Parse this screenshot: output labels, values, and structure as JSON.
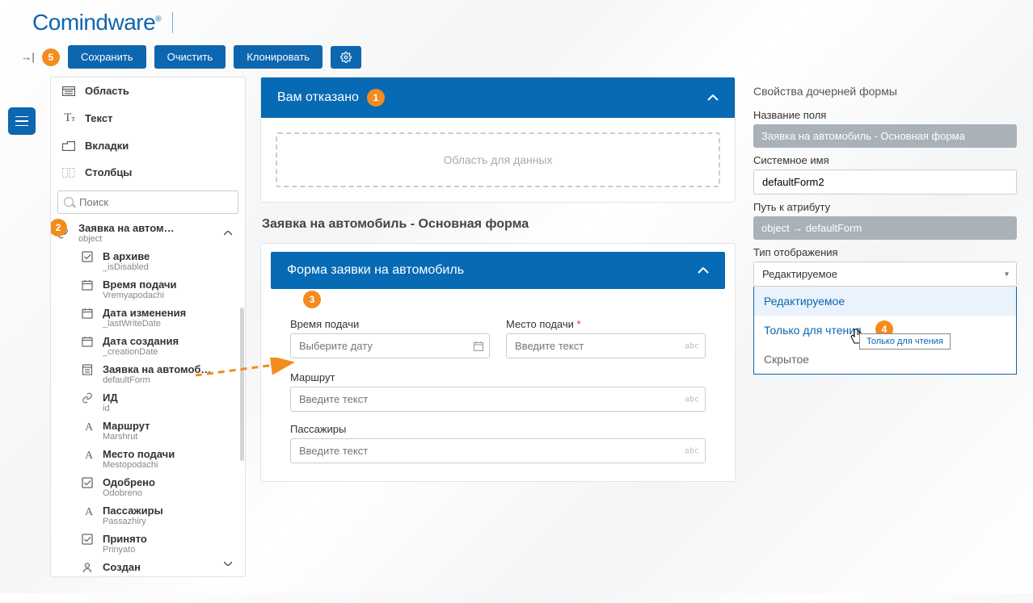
{
  "logo": {
    "text": "Comindware",
    "reg": "®"
  },
  "toolbar": {
    "expand_tip": "→|",
    "save_label": "Сохранить",
    "clear_label": "Очистить",
    "clone_label": "Клонировать"
  },
  "steps": {
    "s1": "1",
    "s2": "2",
    "s3": "3",
    "s4": "4",
    "s5": "5"
  },
  "palette": {
    "area": "Область",
    "text": "Текст",
    "tabs": "Вкладки",
    "columns": "Столбцы",
    "search_placeholder": "Поиск"
  },
  "tree": {
    "root": {
      "title": "Заявка на автом…",
      "sub": "object"
    },
    "items": [
      {
        "icon": "check",
        "title": "В архиве",
        "sub": "_isDisabled"
      },
      {
        "icon": "cal",
        "title": "Время подачи",
        "sub": "Vremyapodachi"
      },
      {
        "icon": "cal",
        "title": "Дата изменения",
        "sub": "_lastWriteDate"
      },
      {
        "icon": "cal",
        "title": "Дата создания",
        "sub": "_creationDate"
      },
      {
        "icon": "form",
        "title": "Заявка на автомоб…",
        "sub": "defaultForm"
      },
      {
        "icon": "link",
        "title": "ИД",
        "sub": "id"
      },
      {
        "icon": "A",
        "title": "Маршрут",
        "sub": "Marshrut"
      },
      {
        "icon": "A",
        "title": "Место подачи",
        "sub": "Mestopodachi"
      },
      {
        "icon": "check",
        "title": "Одобрено",
        "sub": "Odobreno"
      },
      {
        "icon": "A",
        "title": "Пассажиры",
        "sub": "Passazhiry"
      },
      {
        "icon": "check",
        "title": "Принято",
        "sub": "Prinyato"
      },
      {
        "icon": "user",
        "title": "Создан",
        "sub": ""
      }
    ]
  },
  "canvas": {
    "denied_title": "Вам отказано",
    "dropzone": "Область для данных",
    "subform_title": "Заявка на автомобиль - Основная форма",
    "inner_title": "Форма заявки на автомобиль",
    "fields": {
      "time_label": "Время подачи",
      "time_placeholder": "Выберите дату",
      "place_label": "Место подачи",
      "place_placeholder": "Введите текст",
      "route_label": "Маршрут",
      "route_placeholder": "Введите текст",
      "pass_label": "Пассажиры",
      "pass_placeholder": "Введите текст"
    }
  },
  "props": {
    "title": "Свойства дочерней формы",
    "name_label": "Название поля",
    "name_value": "Заявка на автомобиль - Основная форма",
    "sys_label": "Системное имя",
    "sys_value": "defaultForm2",
    "path_label": "Путь к атрибуту",
    "path_value": "object → defaultForm",
    "type_label": "Тип отображения",
    "type_value": "Редактируемое",
    "options": {
      "editable": "Редактируемое",
      "readonly": "Только для чтения",
      "hidden": "Скрытое"
    },
    "tooltip": "Только для чтения"
  }
}
